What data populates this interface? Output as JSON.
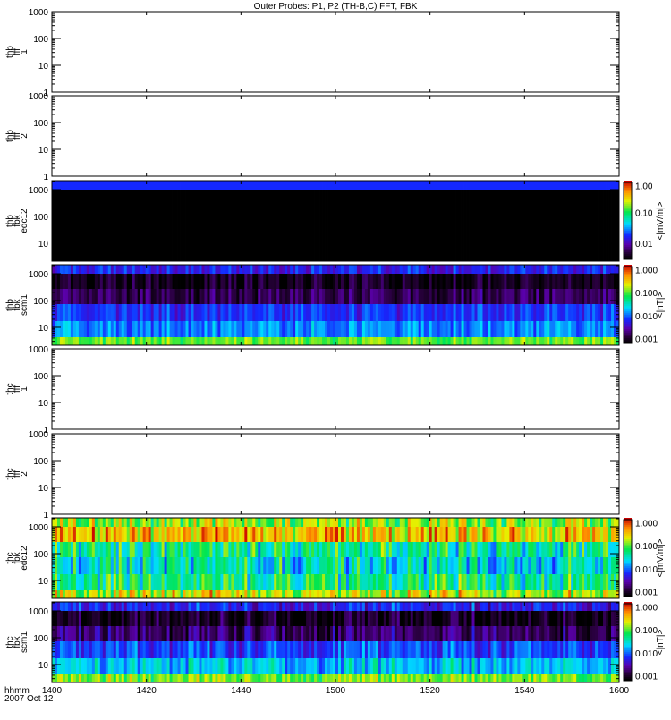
{
  "chart_data": {
    "type": "heatmap",
    "title": "Outer Probes: P1, P2 (TH-B,C) FFT, FBK",
    "x": {
      "label_line1": "hhmm",
      "label_line2": "2007 Oct 12",
      "range": [
        1400,
        1600
      ],
      "ticks": [
        "1400",
        "1420",
        "1440",
        "1500",
        "1520",
        "1540",
        "1600"
      ]
    },
    "panels": [
      {
        "ylabel": [
          "thb",
          "fff",
          "1"
        ],
        "kind": "empty",
        "ylim": [
          1,
          1000
        ],
        "yticks": [
          "1000",
          "100",
          "10",
          "1"
        ]
      },
      {
        "ylabel": [
          "thb",
          "fff",
          "2"
        ],
        "kind": "empty",
        "ylim": [
          1,
          1000
        ],
        "yticks": [
          "1000",
          "100",
          "10",
          "1"
        ]
      },
      {
        "ylabel": [
          "thb",
          "fbk",
          "edc12"
        ],
        "kind": "spec",
        "ylim": [
          2.15,
          2154
        ],
        "yticks": [
          "1000",
          "100",
          "10"
        ],
        "band_levels": [
          0.3,
          -1,
          -1,
          -1,
          -1,
          -1
        ],
        "jitter": 0.0,
        "colorbar": {
          "title": "<|mV/m|>",
          "ticks": [
            "1.00",
            "0.10",
            "0.01"
          ],
          "tick_pos": [
            0.95,
            0.6,
            0.2
          ]
        }
      },
      {
        "ylabel": [
          "thb",
          "fbk",
          "scm1"
        ],
        "kind": "spec",
        "ylim": [
          2.15,
          2154
        ],
        "yticks": [
          "1000",
          "100",
          "10"
        ],
        "band_levels": [
          0.27,
          0.04,
          0.1,
          0.3,
          0.38,
          0.66
        ],
        "jitter": 0.06,
        "colorbar": {
          "title": "<|nT|>",
          "ticks": [
            "1.000",
            "0.100",
            "0.010",
            "0.001"
          ],
          "tick_pos": [
            0.95,
            0.65,
            0.35,
            0.05
          ]
        }
      },
      {
        "ylabel": [
          "thc",
          "fff",
          "1"
        ],
        "kind": "empty",
        "ylim": [
          1,
          1000
        ],
        "yticks": [
          "1000",
          "100",
          "10",
          "1"
        ]
      },
      {
        "ylabel": [
          "thc",
          "fff",
          "2"
        ],
        "kind": "empty",
        "ylim": [
          1,
          1000
        ],
        "yticks": [
          "1000",
          "100",
          "10",
          "1"
        ]
      },
      {
        "ylabel": [
          "thc",
          "fbk",
          "edc12"
        ],
        "kind": "spec",
        "ylim": [
          2.15,
          2154
        ],
        "yticks": [
          "1000",
          "100",
          "10"
        ],
        "band_levels": [
          0.7,
          0.82,
          0.55,
          0.5,
          0.58,
          0.74
        ],
        "jitter": 0.12,
        "colorbar": {
          "title": "<|mV/m|>",
          "ticks": [
            "1.000",
            "0.100",
            "0.010",
            "0.001"
          ],
          "tick_pos": [
            0.95,
            0.65,
            0.35,
            0.05
          ]
        }
      },
      {
        "ylabel": [
          "thc",
          "fbk",
          "scm1"
        ],
        "kind": "spec",
        "ylim": [
          2.15,
          2154
        ],
        "yticks": [
          "1000",
          "100",
          "10"
        ],
        "band_levels": [
          0.27,
          0.04,
          0.12,
          0.32,
          0.44,
          0.68
        ],
        "jitter": 0.08,
        "colorbar": {
          "title": "<|nT|>",
          "ticks": [
            "1.000",
            "0.100",
            "0.010",
            "0.001"
          ],
          "tick_pos": [
            0.95,
            0.65,
            0.35,
            0.05
          ]
        }
      }
    ]
  }
}
